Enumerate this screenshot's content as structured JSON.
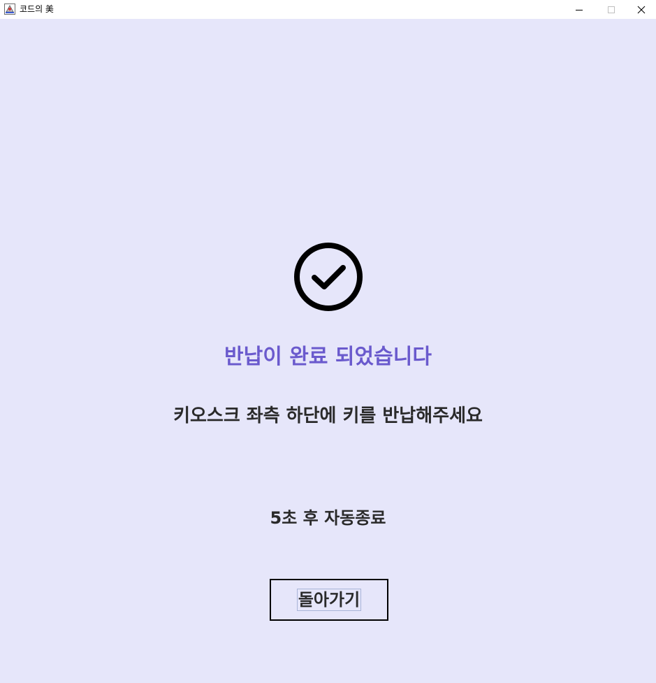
{
  "window": {
    "title": "코드의 美",
    "app_icon": "java-app-icon",
    "controls": {
      "minimize_icon": "minimize-icon",
      "maximize_icon": "maximize-icon",
      "close_icon": "close-icon"
    }
  },
  "main": {
    "status_icon": "check-circle-icon",
    "headline": "반납이 완료 되었습니다",
    "instruction": "키오스크 좌측 하단에 키를 반납해주세요",
    "countdown": "5초 후 자동종료",
    "back_button_label": "돌아가기"
  },
  "colors": {
    "background": "#e6e6fa",
    "headline": "#6a5acd",
    "text": "#2a2a2a"
  }
}
